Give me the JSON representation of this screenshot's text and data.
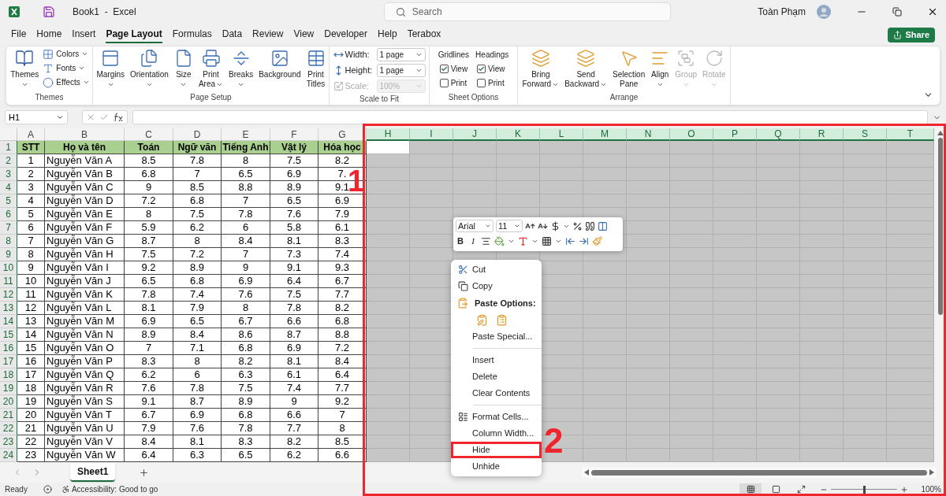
{
  "window": {
    "title": "Book1  -  Excel",
    "search_placeholder": "Search",
    "user": "Toàn Phạm"
  },
  "menu_tabs": [
    {
      "label": "File",
      "selected": false
    },
    {
      "label": "Home",
      "selected": false
    },
    {
      "label": "Insert",
      "selected": false
    },
    {
      "label": "Page Layout",
      "selected": true
    },
    {
      "label": "Formulas",
      "selected": false
    },
    {
      "label": "Data",
      "selected": false
    },
    {
      "label": "Review",
      "selected": false
    },
    {
      "label": "View",
      "selected": false
    },
    {
      "label": "Developer",
      "selected": false
    },
    {
      "label": "Help",
      "selected": false
    },
    {
      "label": "Terabox",
      "selected": false
    }
  ],
  "share_button": "Share",
  "ribbon": {
    "themes": {
      "label": "Themes",
      "large": {
        "lines": [
          "Themes"
        ],
        "caret": true
      },
      "small": [
        {
          "label": "Colors"
        },
        {
          "label": "Fonts"
        },
        {
          "label": "Effects"
        }
      ]
    },
    "page_setup": {
      "label": "Page Setup",
      "buttons": [
        {
          "lines": [
            "Margins"
          ],
          "caret": true
        },
        {
          "lines": [
            "Orientation"
          ],
          "caret": true
        },
        {
          "lines": [
            "Size"
          ],
          "caret": true
        },
        {
          "lines": [
            "Print",
            "Area"
          ],
          "caret": true
        },
        {
          "lines": [
            "Breaks"
          ],
          "caret": true
        },
        {
          "lines": [
            "Background"
          ],
          "caret": false
        },
        {
          "lines": [
            "Print",
            "Titles"
          ],
          "caret": false
        }
      ]
    },
    "scale_to_fit": {
      "label": "Scale to Fit",
      "fields": [
        {
          "label": "Width:",
          "value": "1 page",
          "disabled": false
        },
        {
          "label": "Height:",
          "value": "1 page",
          "disabled": false
        },
        {
          "label": "Scale:",
          "value": "100%",
          "disabled": true
        }
      ]
    },
    "sheet_options": {
      "label": "Sheet Options",
      "columns": [
        {
          "label": "Gridlines",
          "options": [
            {
              "label": "View",
              "checked": true
            },
            {
              "label": "Print",
              "checked": false
            }
          ]
        },
        {
          "label": "Headings",
          "options": [
            {
              "label": "View",
              "checked": true
            },
            {
              "label": "Print",
              "checked": false
            }
          ]
        }
      ]
    },
    "arrange": {
      "label": "Arrange",
      "buttons": [
        {
          "lines": [
            "Bring",
            "Forward"
          ],
          "caret": true,
          "disabled": false
        },
        {
          "lines": [
            "Send",
            "Backward"
          ],
          "caret": true,
          "disabled": false
        },
        {
          "lines": [
            "Selection",
            "Pane"
          ],
          "caret": false,
          "disabled": false
        },
        {
          "lines": [
            "Align"
          ],
          "caret": true,
          "disabled": false
        },
        {
          "lines": [
            "Group"
          ],
          "caret": true,
          "disabled": true
        },
        {
          "lines": [
            "Rotate"
          ],
          "caret": true,
          "disabled": true
        }
      ]
    }
  },
  "formula_bar": {
    "name_box": "H1"
  },
  "sheet": {
    "columns": [
      {
        "label": "A",
        "selected": false
      },
      {
        "label": "B",
        "selected": false
      },
      {
        "label": "C",
        "selected": false
      },
      {
        "label": "D",
        "selected": false
      },
      {
        "label": "E",
        "selected": false
      },
      {
        "label": "F",
        "selected": false
      },
      {
        "label": "G",
        "selected": false
      },
      {
        "label": "H",
        "selected": true
      },
      {
        "label": "I",
        "selected": true
      },
      {
        "label": "J",
        "selected": true
      },
      {
        "label": "K",
        "selected": true
      },
      {
        "label": "L",
        "selected": true
      },
      {
        "label": "M",
        "selected": true
      },
      {
        "label": "N",
        "selected": true
      },
      {
        "label": "O",
        "selected": true
      },
      {
        "label": "P",
        "selected": true
      },
      {
        "label": "Q",
        "selected": true
      },
      {
        "label": "R",
        "selected": true
      },
      {
        "label": "S",
        "selected": true
      },
      {
        "label": "T",
        "selected": true
      }
    ],
    "rows": [
      {
        "number": "1",
        "selected": true,
        "kind": "header",
        "cells": [
          "STT",
          "Họ và tên",
          "Toán",
          "Ngữ văn",
          "Tiếng Anh",
          "Vật lý",
          "Hóa học"
        ]
      },
      {
        "number": "2",
        "selected": true,
        "kind": "data",
        "cells": [
          "1",
          "Nguyễn Văn A",
          "8.5",
          "7.8",
          "8",
          "7.5",
          "8.2"
        ]
      },
      {
        "number": "3",
        "selected": true,
        "kind": "data",
        "cells": [
          "2",
          "Nguyễn Văn B",
          "6.8",
          "7",
          "6.5",
          "6.9",
          "7."
        ]
      },
      {
        "number": "4",
        "selected": true,
        "kind": "data",
        "cells": [
          "3",
          "Nguyễn Văn C",
          "9",
          "8.5",
          "8.8",
          "8.9",
          "9.1"
        ]
      },
      {
        "number": "5",
        "selected": true,
        "kind": "data",
        "cells": [
          "4",
          "Nguyễn Văn D",
          "7.2",
          "6.8",
          "7",
          "6.5",
          "6.9"
        ]
      },
      {
        "number": "6",
        "selected": true,
        "kind": "data",
        "cells": [
          "5",
          "Nguyễn Văn E",
          "8",
          "7.5",
          "7.8",
          "7.6",
          "7.9"
        ]
      },
      {
        "number": "7",
        "selected": true,
        "kind": "data",
        "cells": [
          "6",
          "Nguyễn Văn F",
          "5.9",
          "6.2",
          "6",
          "5.8",
          "6.1"
        ]
      },
      {
        "number": "8",
        "selected": true,
        "kind": "data",
        "cells": [
          "7",
          "Nguyễn Văn G",
          "8.7",
          "8",
          "8.4",
          "8.1",
          "8.3"
        ]
      },
      {
        "number": "9",
        "selected": true,
        "kind": "data",
        "cells": [
          "8",
          "Nguyễn Văn H",
          "7.5",
          "7.2",
          "7",
          "7.3",
          "7.4"
        ]
      },
      {
        "number": "10",
        "selected": true,
        "kind": "data",
        "cells": [
          "9",
          "Nguyễn Văn I",
          "9.2",
          "8.9",
          "9",
          "9.1",
          "9.3"
        ]
      },
      {
        "number": "11",
        "selected": true,
        "kind": "data",
        "cells": [
          "10",
          "Nguyễn Văn J",
          "6.5",
          "6.8",
          "6.9",
          "6.4",
          "6.7"
        ]
      },
      {
        "number": "12",
        "selected": true,
        "kind": "data",
        "cells": [
          "11",
          "Nguyễn Văn K",
          "7.8",
          "7.4",
          "7.6",
          "7.5",
          "7.7"
        ]
      },
      {
        "number": "13",
        "selected": true,
        "kind": "data",
        "cells": [
          "12",
          "Nguyễn Văn L",
          "8.1",
          "7.9",
          "8",
          "7.8",
          "8.2"
        ]
      },
      {
        "number": "14",
        "selected": true,
        "kind": "data",
        "cells": [
          "13",
          "Nguyễn Văn M",
          "6.9",
          "6.5",
          "6.7",
          "6.6",
          "6.8"
        ]
      },
      {
        "number": "15",
        "selected": true,
        "kind": "data",
        "cells": [
          "14",
          "Nguyễn Văn N",
          "8.9",
          "8.4",
          "8.6",
          "8.7",
          "8.8"
        ]
      },
      {
        "number": "16",
        "selected": true,
        "kind": "data",
        "cells": [
          "15",
          "Nguyễn Văn O",
          "7",
          "7.1",
          "6.8",
          "6.9",
          "7.2"
        ]
      },
      {
        "number": "17",
        "selected": true,
        "kind": "data",
        "cells": [
          "16",
          "Nguyễn Văn P",
          "8.3",
          "8",
          "8.2",
          "8.1",
          "8.4"
        ]
      },
      {
        "number": "18",
        "selected": true,
        "kind": "data",
        "cells": [
          "17",
          "Nguyễn Văn Q",
          "6.2",
          "6",
          "6.3",
          "6.1",
          "6.4"
        ]
      },
      {
        "number": "19",
        "selected": true,
        "kind": "data",
        "cells": [
          "18",
          "Nguyễn Văn R",
          "7.6",
          "7.8",
          "7.5",
          "7.4",
          "7.7"
        ]
      },
      {
        "number": "20",
        "selected": true,
        "kind": "data",
        "cells": [
          "19",
          "Nguyễn Văn S",
          "9.1",
          "8.7",
          "8.9",
          "9",
          "9.2"
        ]
      },
      {
        "number": "21",
        "selected": true,
        "kind": "data",
        "cells": [
          "20",
          "Nguyễn Văn T",
          "6.7",
          "6.9",
          "6.8",
          "6.6",
          "7"
        ]
      },
      {
        "number": "22",
        "selected": true,
        "kind": "data",
        "cells": [
          "21",
          "Nguyễn Văn U",
          "7.9",
          "7.6",
          "7.8",
          "7.7",
          "8"
        ]
      },
      {
        "number": "23",
        "selected": true,
        "kind": "data",
        "cells": [
          "22",
          "Nguyễn Văn V",
          "8.4",
          "8.1",
          "8.3",
          "8.2",
          "8.5"
        ]
      },
      {
        "number": "24",
        "selected": true,
        "kind": "data",
        "cells": [
          "23",
          "Nguyễn Văn W",
          "6.4",
          "6.3",
          "6.5",
          "6.2",
          "6.6"
        ]
      }
    ]
  },
  "mini_toolbar": {
    "font": "Arial",
    "size": "11",
    "bold": "B",
    "italic": "I"
  },
  "context_menu": [
    {
      "kind": "cut",
      "label": "Cut",
      "marked": false
    },
    {
      "kind": "copy",
      "label": "Copy",
      "marked": false
    },
    {
      "kind": "heading",
      "label": "Paste Options:"
    },
    {
      "kind": "pastes"
    },
    {
      "kind": "plain",
      "label": "Paste Special...",
      "marked": false
    },
    {
      "kind": "separator"
    },
    {
      "kind": "plain",
      "label": "Insert",
      "marked": false
    },
    {
      "kind": "plain",
      "label": "Delete",
      "marked": false
    },
    {
      "kind": "plain",
      "label": "Clear Contents",
      "marked": false
    },
    {
      "kind": "separator"
    },
    {
      "kind": "format",
      "label": "Format Cells...",
      "marked": false
    },
    {
      "kind": "plain",
      "label": "Column Width...",
      "marked": false
    },
    {
      "kind": "plain",
      "label": "Hide",
      "marked": true
    },
    {
      "kind": "plain",
      "label": "Unhide",
      "marked": false
    }
  ],
  "sheet_tabs": [
    {
      "label": "Sheet1",
      "selected": true
    }
  ],
  "status_bar": {
    "ready": "Ready",
    "accessibility": "Accessibility: Good to go",
    "views": [
      {
        "selected": true
      },
      {
        "selected": false
      },
      {
        "selected": false
      }
    ],
    "zoom": {
      "level": 0.5,
      "reading": "100%"
    }
  },
  "annotations": {
    "frame_marker": "1",
    "menu_marker": "2"
  }
}
